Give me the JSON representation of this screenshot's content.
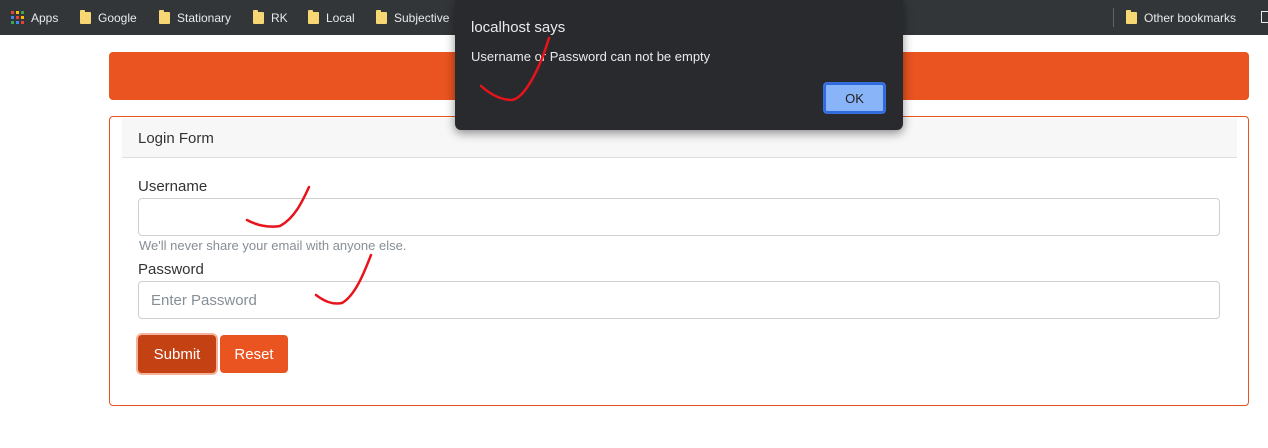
{
  "bookmarks_bar": {
    "items": [
      {
        "label": "Apps",
        "icon": "apps-grid-icon"
      },
      {
        "label": "Google",
        "icon": "folder-icon"
      },
      {
        "label": "Stationary",
        "icon": "folder-icon"
      },
      {
        "label": "RK",
        "icon": "folder-icon"
      },
      {
        "label": "Local",
        "icon": "folder-icon"
      },
      {
        "label": "Subjective",
        "icon": "folder-icon"
      }
    ],
    "other_bookmarks": "Other bookmarks"
  },
  "page": {
    "accent_color": "#e95420",
    "login_card": {
      "title": "Login Form",
      "username_label": "Username",
      "username_value": "",
      "username_help": "We'll never share your email with anyone else.",
      "password_label": "Password",
      "password_value": "",
      "password_placeholder": "Enter Password",
      "submit_label": "Submit",
      "reset_label": "Reset"
    }
  },
  "alert_dialog": {
    "title": "localhost says",
    "message": "Username or Password can not be empty",
    "ok_label": "OK"
  },
  "annotations": {
    "color": "#e8131b",
    "marks": [
      "red-checkmark",
      "red-checkmark",
      "red-checkmark"
    ]
  }
}
